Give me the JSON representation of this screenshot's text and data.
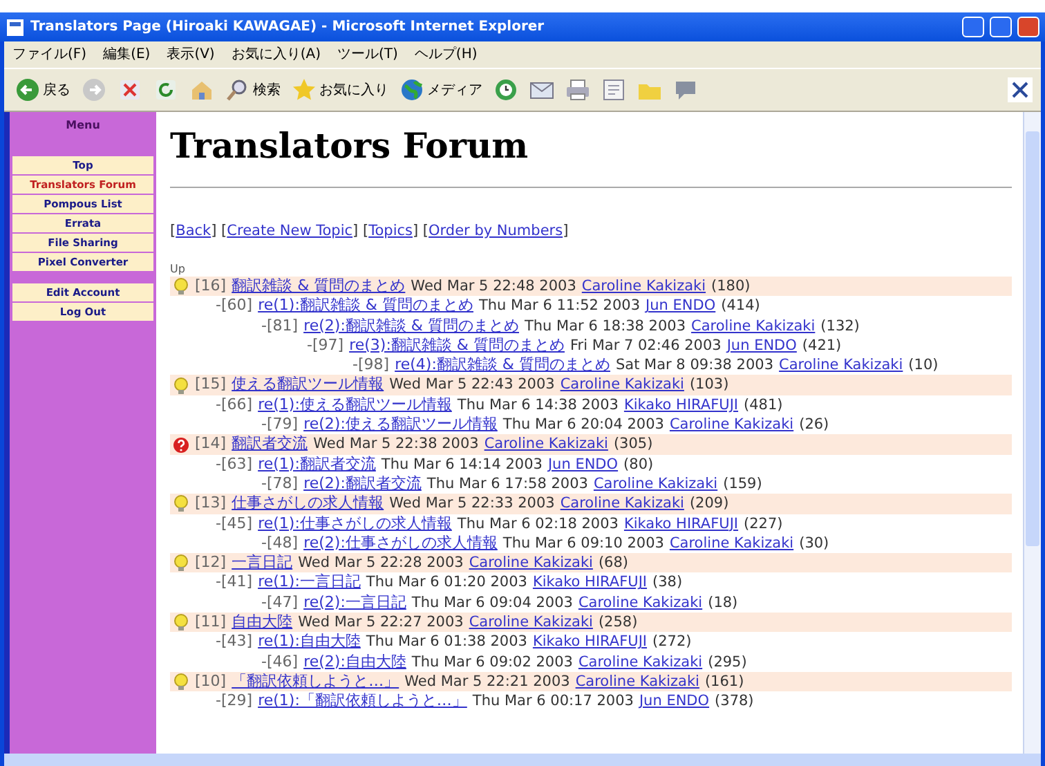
{
  "window": {
    "title": "Translators Page (Hiroaki KAWAGAE) - Microsoft Internet Explorer"
  },
  "menu_bar": [
    "ファイル(F)",
    "編集(E)",
    "表示(V)",
    "お気に入り(A)",
    "ツール(T)",
    "ヘルプ(H)"
  ],
  "toolbar": [
    {
      "kind": "back",
      "label": "戻る"
    },
    {
      "kind": "forward"
    },
    {
      "kind": "stop"
    },
    {
      "kind": "refresh"
    },
    {
      "kind": "home"
    },
    {
      "kind": "search",
      "label": "検索"
    },
    {
      "kind": "favorites",
      "label": "お気に入り"
    },
    {
      "kind": "media",
      "label": "メディア"
    },
    {
      "kind": "history"
    },
    {
      "kind": "mail"
    },
    {
      "kind": "print"
    },
    {
      "kind": "edit"
    },
    {
      "kind": "folder"
    },
    {
      "kind": "messenger"
    }
  ],
  "sidebar": {
    "title": "Menu",
    "items": [
      {
        "label": "Top",
        "selected": false
      },
      {
        "label": "Translators Forum",
        "selected": true
      },
      {
        "label": "Pompous List",
        "selected": false
      },
      {
        "label": "Errata",
        "selected": false
      },
      {
        "label": "File Sharing",
        "selected": false
      },
      {
        "label": "Pixel Converter",
        "selected": false
      },
      {
        "kind": "gap"
      },
      {
        "label": "Edit Account",
        "selected": false
      },
      {
        "label": "Log Out",
        "selected": false
      }
    ]
  },
  "page": {
    "heading": "Translators Forum",
    "links": [
      {
        "before": "[",
        "label": "Back",
        "after": "]"
      },
      {
        "before": " [",
        "label": "Create New Topic",
        "after": "]"
      },
      {
        "before": " [",
        "label": "Topics",
        "after": "]"
      },
      {
        "before": " [",
        "label": "Order by Numbers",
        "after": "]"
      }
    ],
    "up_label": "Up"
  },
  "threads": [
    {
      "kind": "bulb",
      "number": "[16]",
      "title": "翻訳雑談 & 質問のまとめ",
      "date": "Wed Mar 5 22:48 2003",
      "author": "Caroline Kakizaki",
      "count": "(180)",
      "children": [
        {
          "number": "-[60]",
          "title": "re(1):翻訳雑談 & 質問のまとめ",
          "date": "Thu Mar 6 11:52 2003",
          "author": "Jun ENDO",
          "count": "(414)",
          "children": [
            {
              "number": "-[81]",
              "title": "re(2):翻訳雑談 & 質問のまとめ",
              "date": "Thu Mar 6 18:38 2003",
              "author": "Caroline Kakizaki",
              "count": "(132)",
              "children": [
                {
                  "number": "-[97]",
                  "title": "re(3):翻訳雑談 & 質問のまとめ",
                  "date": "Fri Mar 7 02:46 2003",
                  "author": "Jun ENDO",
                  "count": "(421)",
                  "children": [
                    {
                      "number": "-[98]",
                      "title": "re(4):翻訳雑談 & 質問のまとめ",
                      "date": "Sat Mar 8 09:38 2003",
                      "author": "Caroline Kakizaki",
                      "count": "(10)"
                    }
                  ]
                }
              ]
            }
          ]
        }
      ]
    },
    {
      "kind": "bulb",
      "number": "[15]",
      "title": "使える翻訳ツール情報",
      "date": "Wed Mar 5 22:43 2003",
      "author": "Caroline Kakizaki",
      "count": "(103)",
      "children": [
        {
          "number": "-[66]",
          "title": "re(1):使える翻訳ツール情報",
          "date": "Thu Mar 6 14:38 2003",
          "author": "Kikako HIRAFUJI",
          "count": "(481)",
          "children": [
            {
              "number": "-[79]",
              "title": "re(2):使える翻訳ツール情報",
              "date": "Thu Mar 6 20:04 2003",
              "author": "Caroline Kakizaki",
              "count": "(26)"
            }
          ]
        }
      ]
    },
    {
      "kind": "question",
      "number": "[14]",
      "title": "翻訳者交流",
      "date": "Wed Mar 5 22:38 2003",
      "author": "Caroline Kakizaki",
      "count": "(305)",
      "children": [
        {
          "number": "-[63]",
          "title": "re(1):翻訳者交流",
          "date": "Thu Mar 6 14:14 2003",
          "author": "Jun ENDO",
          "count": "(80)",
          "children": [
            {
              "number": "-[78]",
              "title": "re(2):翻訳者交流",
              "date": "Thu Mar 6 17:58 2003",
              "author": "Caroline Kakizaki",
              "count": "(159)"
            }
          ]
        }
      ]
    },
    {
      "kind": "bulb",
      "number": "[13]",
      "title": "仕事さがしの求人情報",
      "date": "Wed Mar 5 22:33 2003",
      "author": "Caroline Kakizaki",
      "count": "(209)",
      "children": [
        {
          "number": "-[45]",
          "title": "re(1):仕事さがしの求人情報",
          "date": "Thu Mar 6 02:18 2003",
          "author": "Kikako HIRAFUJI",
          "count": "(227)",
          "children": [
            {
              "number": "-[48]",
              "title": "re(2):仕事さがしの求人情報",
              "date": "Thu Mar 6 09:10 2003",
              "author": "Caroline Kakizaki",
              "count": "(30)"
            }
          ]
        }
      ]
    },
    {
      "kind": "bulb",
      "number": "[12]",
      "title": "一言日記",
      "date": "Wed Mar 5 22:28 2003",
      "author": "Caroline Kakizaki",
      "count": "(68)",
      "children": [
        {
          "number": "-[41]",
          "title": "re(1):一言日記",
          "date": "Thu Mar 6 01:20 2003",
          "author": "Kikako HIRAFUJI",
          "count": "(38)",
          "children": [
            {
              "number": "-[47]",
              "title": "re(2):一言日記",
              "date": "Thu Mar 6 09:04 2003",
              "author": "Caroline Kakizaki",
              "count": "(18)"
            }
          ]
        }
      ]
    },
    {
      "kind": "bulb",
      "number": "[11]",
      "title": "自由大陸",
      "date": "Wed Mar 5 22:27 2003",
      "author": "Caroline Kakizaki",
      "count": "(258)",
      "children": [
        {
          "number": "-[43]",
          "title": "re(1):自由大陸",
          "date": "Thu Mar 6 01:38 2003",
          "author": "Kikako HIRAFUJI",
          "count": "(272)",
          "children": [
            {
              "number": "-[46]",
              "title": "re(2):自由大陸",
              "date": "Thu Mar 6 09:02 2003",
              "author": "Caroline Kakizaki",
              "count": "(295)"
            }
          ]
        }
      ]
    },
    {
      "kind": "bulb",
      "number": "[10]",
      "title": "「翻訳依頼しようと…」",
      "date": "Wed Mar 5 22:21 2003",
      "author": "Caroline Kakizaki",
      "count": "(161)",
      "children": [
        {
          "number": "-[29]",
          "title": "re(1):「翻訳依頼しようと…」",
          "date": "Thu Mar 6 00:17 2003",
          "author": "Jun ENDO",
          "count": "(378)"
        }
      ]
    }
  ]
}
